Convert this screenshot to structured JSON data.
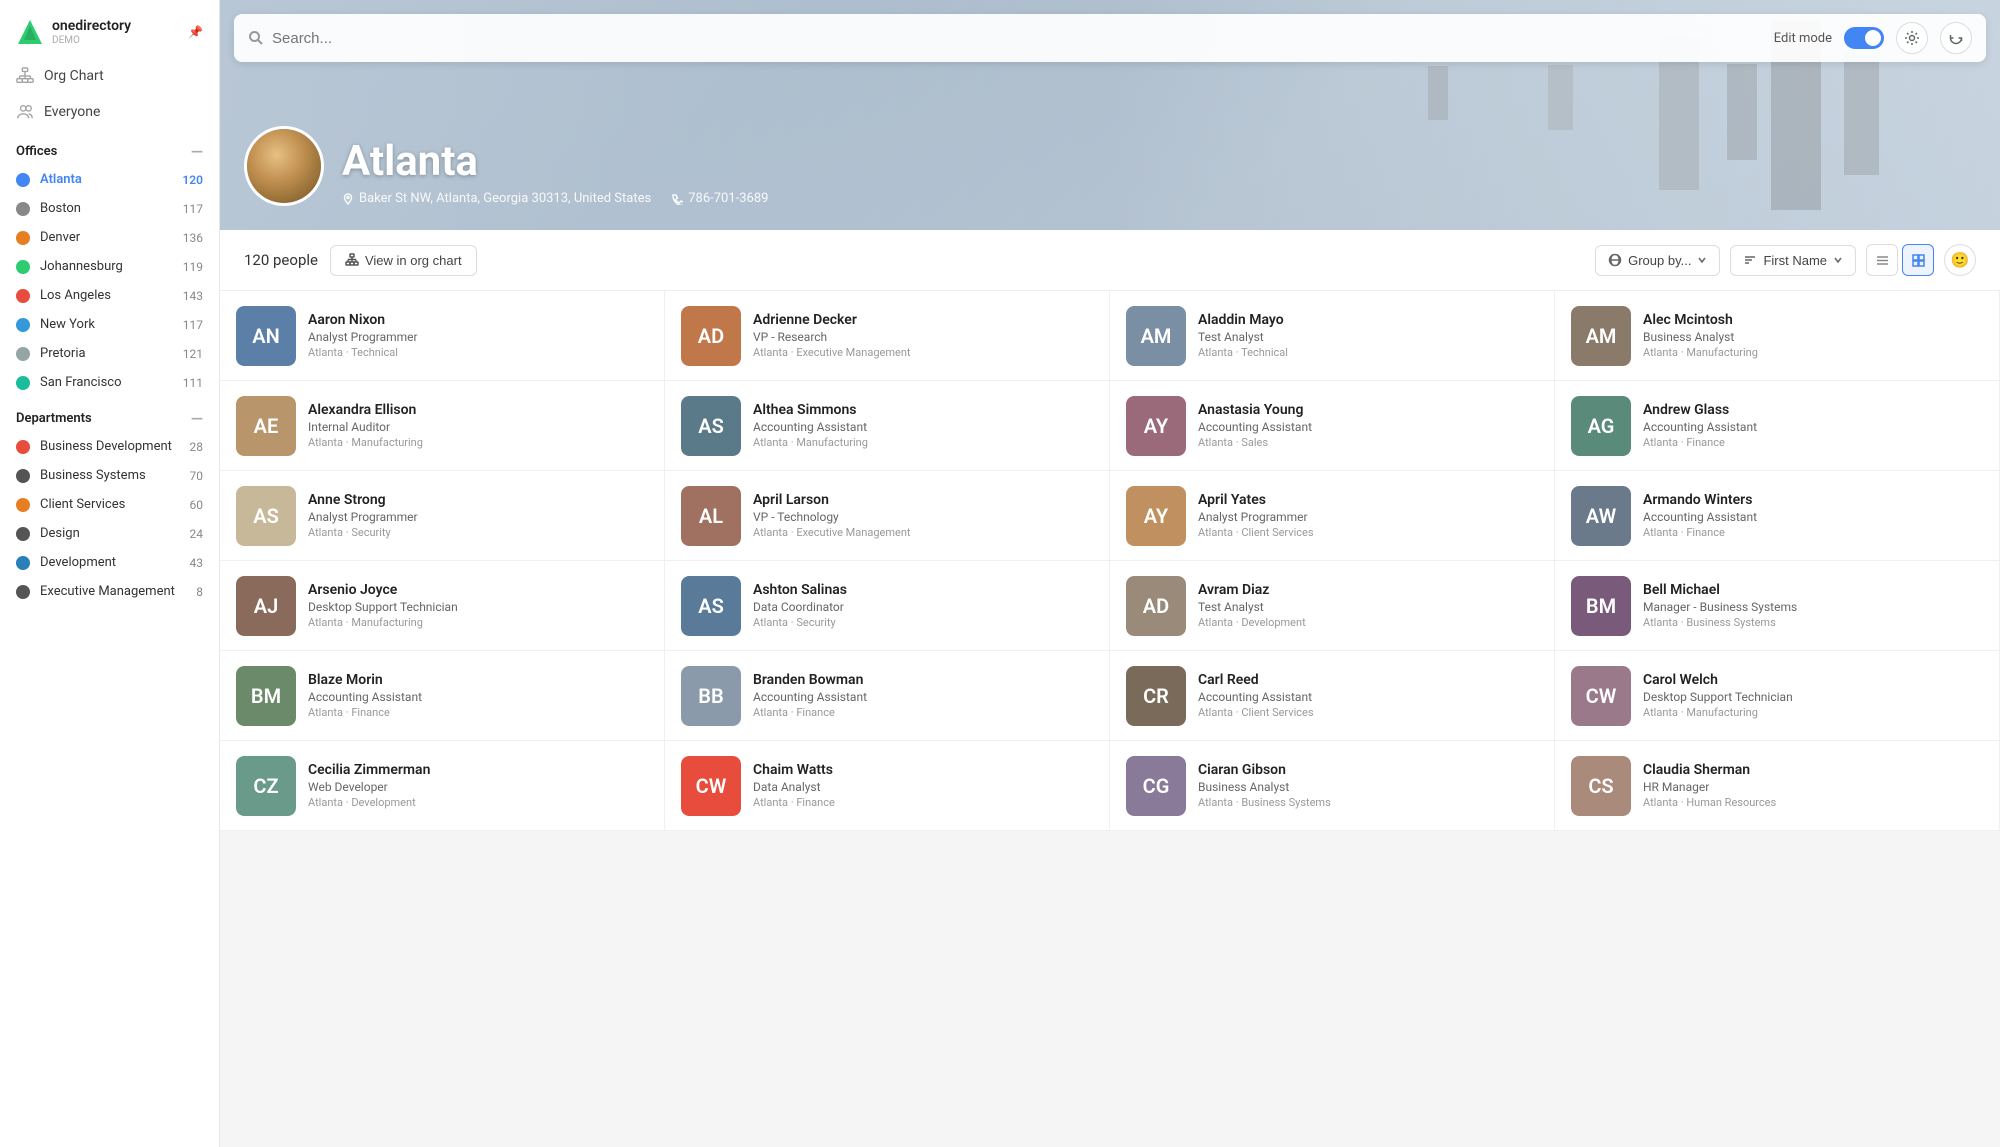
{
  "logo": {
    "name": "onedirectory",
    "sub": "DEMO"
  },
  "nav": {
    "items": [
      {
        "id": "org-chart",
        "label": "Org Chart",
        "icon": "org"
      },
      {
        "id": "everyone",
        "label": "Everyone",
        "icon": "people"
      }
    ]
  },
  "offices_section": {
    "title": "Offices",
    "items": [
      {
        "id": "atlanta",
        "label": "Atlanta",
        "count": "120",
        "active": true,
        "color": "#4285f4"
      },
      {
        "id": "boston",
        "label": "Boston",
        "count": "117",
        "active": false,
        "color": "#888"
      },
      {
        "id": "denver",
        "label": "Denver",
        "count": "136",
        "active": false,
        "color": "#e67e22"
      },
      {
        "id": "johannesburg",
        "label": "Johannesburg",
        "count": "119",
        "active": false,
        "color": "#2ecc71"
      },
      {
        "id": "los-angeles",
        "label": "Los Angeles",
        "count": "143",
        "active": false,
        "color": "#e74c3c"
      },
      {
        "id": "new-york",
        "label": "New York",
        "count": "117",
        "active": false,
        "color": "#3498db"
      },
      {
        "id": "pretoria",
        "label": "Pretoria",
        "count": "121",
        "active": false,
        "color": "#95a5a6"
      },
      {
        "id": "san-francisco",
        "label": "San Francisco",
        "count": "111",
        "active": false,
        "color": "#1abc9c"
      }
    ]
  },
  "departments_section": {
    "title": "Departments",
    "items": [
      {
        "id": "business-dev",
        "label": "Business Development",
        "count": "28",
        "color": "#e74c3c"
      },
      {
        "id": "business-sys",
        "label": "Business Systems",
        "count": "70",
        "color": "#555"
      },
      {
        "id": "client-services",
        "label": "Client Services",
        "count": "60",
        "color": "#e67e22"
      },
      {
        "id": "design",
        "label": "Design",
        "count": "24",
        "color": "#555"
      },
      {
        "id": "development",
        "label": "Development",
        "count": "43",
        "color": "#2980b9"
      },
      {
        "id": "exec-mgmt",
        "label": "Executive Management",
        "count": "8",
        "color": "#555"
      }
    ]
  },
  "search": {
    "placeholder": "Search..."
  },
  "edit_mode": {
    "label": "Edit mode"
  },
  "hero": {
    "city": "Atlanta",
    "address": "Baker St NW, Atlanta, Georgia 30313, United States",
    "phone": "786-701-3689"
  },
  "toolbar": {
    "people_count": "120 people",
    "view_org_label": "View in org chart",
    "group_by_label": "Group by...",
    "sort_label": "First Name"
  },
  "people": [
    {
      "id": 1,
      "name": "Aaron Nixon",
      "title": "Analyst Programmer",
      "location": "Atlanta · Technical",
      "color": "#5b7fa6",
      "initials": "AN"
    },
    {
      "id": 2,
      "name": "Adrienne Decker",
      "title": "VP - Research",
      "location": "Atlanta · Executive Management",
      "color": "#c0784a",
      "initials": "AD"
    },
    {
      "id": 3,
      "name": "Aladdin Mayo",
      "title": "Test Analyst",
      "location": "Atlanta · Technical",
      "color": "#7a8fa3",
      "initials": "AM"
    },
    {
      "id": 4,
      "name": "Alec Mcintosh",
      "title": "Business Analyst",
      "location": "Atlanta · Manufacturing",
      "color": "#8a7a6a",
      "initials": "AM"
    },
    {
      "id": 5,
      "name": "Alexandra Ellison",
      "title": "Internal Auditor",
      "location": "Atlanta · Manufacturing",
      "color": "#b8956a",
      "initials": "AE"
    },
    {
      "id": 6,
      "name": "Althea Simmons",
      "title": "Accounting Assistant",
      "location": "Atlanta · Manufacturing",
      "color": "#5a7a8a",
      "initials": "AS"
    },
    {
      "id": 7,
      "name": "Anastasia Young",
      "title": "Accounting Assistant",
      "location": "Atlanta · Sales",
      "color": "#9a6a7a",
      "initials": "AY"
    },
    {
      "id": 8,
      "name": "Andrew Glass",
      "title": "Accounting Assistant",
      "location": "Atlanta · Finance",
      "color": "#5a8a7a",
      "initials": "AG"
    },
    {
      "id": 9,
      "name": "Anne Strong",
      "title": "Analyst Programmer",
      "location": "Atlanta · Security",
      "color": "#c8b89a",
      "initials": "AS"
    },
    {
      "id": 10,
      "name": "April Larson",
      "title": "VP - Technology",
      "location": "Atlanta · Executive Management",
      "color": "#a07060",
      "initials": "AL"
    },
    {
      "id": 11,
      "name": "April Yates",
      "title": "Analyst Programmer",
      "location": "Atlanta · Client Services",
      "color": "#c09060",
      "initials": "AY"
    },
    {
      "id": 12,
      "name": "Armando Winters",
      "title": "Accounting Assistant",
      "location": "Atlanta · Finance",
      "color": "#6a7a8a",
      "initials": "AW"
    },
    {
      "id": 13,
      "name": "Arsenio Joyce",
      "title": "Desktop Support Technician",
      "location": "Atlanta · Manufacturing",
      "color": "#8a6a5a",
      "initials": "AJ"
    },
    {
      "id": 14,
      "name": "Ashton Salinas",
      "title": "Data Coordinator",
      "location": "Atlanta · Security",
      "color": "#5a7a9a",
      "initials": "AS"
    },
    {
      "id": 15,
      "name": "Avram Diaz",
      "title": "Test Analyst",
      "location": "Atlanta · Development",
      "color": "#9a8a7a",
      "initials": "AD"
    },
    {
      "id": 16,
      "name": "Bell Michael",
      "title": "Manager - Business Systems",
      "location": "Atlanta · Business Systems",
      "color": "#7a5a7a",
      "initials": "BM"
    },
    {
      "id": 17,
      "name": "Blaze Morin",
      "title": "Accounting Assistant",
      "location": "Atlanta · Finance",
      "color": "#6a8a6a",
      "initials": "BM"
    },
    {
      "id": 18,
      "name": "Branden Bowman",
      "title": "Accounting Assistant",
      "location": "Atlanta · Finance",
      "color": "#8a9aaa",
      "initials": "BB"
    },
    {
      "id": 19,
      "name": "Carl Reed",
      "title": "Accounting Assistant",
      "location": "Atlanta · Client Services",
      "color": "#7a6a5a",
      "initials": "CR"
    },
    {
      "id": 20,
      "name": "Carol Welch",
      "title": "Desktop Support Technician",
      "location": "Atlanta · Manufacturing",
      "color": "#9a7a8a",
      "initials": "CW"
    },
    {
      "id": 21,
      "name": "Cecilia Zimmerman",
      "title": "Web Developer",
      "location": "Atlanta · Development",
      "color": "#6a9a8a",
      "initials": "CZ"
    },
    {
      "id": 22,
      "name": "Chaim Watts",
      "title": "Data Analyst",
      "location": "Atlanta · Finance",
      "color": "#e74c3c",
      "initials": "CW"
    },
    {
      "id": 23,
      "name": "Ciaran Gibson",
      "title": "Business Analyst",
      "location": "Atlanta · Business Systems",
      "color": "#8a7a9a",
      "initials": "CG"
    },
    {
      "id": 24,
      "name": "Claudia Sherman",
      "title": "HR Manager",
      "location": "Atlanta · Human Resources",
      "color": "#aa8a7a",
      "initials": "CS"
    }
  ]
}
